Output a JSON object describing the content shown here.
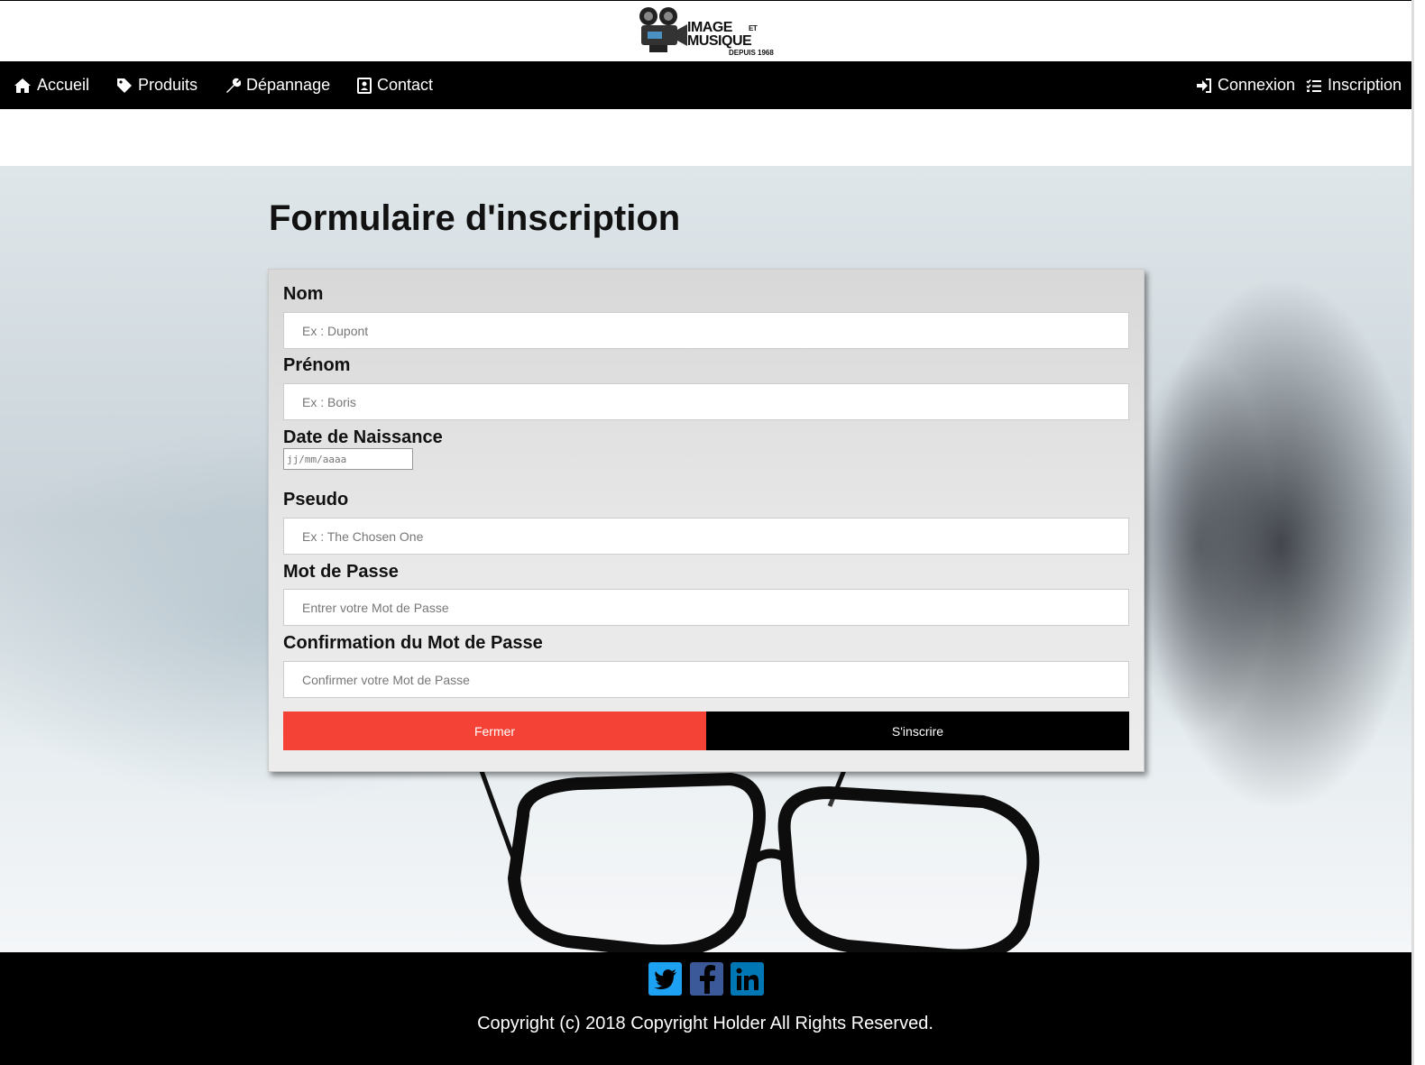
{
  "logo": {
    "line1": "IMAGE",
    "et": "ET",
    "line2": "MUSIQUE",
    "since": "DEPUIS 1968"
  },
  "nav": {
    "left": [
      {
        "label": "Accueil",
        "icon": "home-icon"
      },
      {
        "label": "Produits",
        "icon": "tag-icon"
      },
      {
        "label": "Dépannage",
        "icon": "wrench-icon"
      },
      {
        "label": "Contact",
        "icon": "contact-card-icon"
      }
    ],
    "right": [
      {
        "label": "Connexion",
        "icon": "sign-in-icon"
      },
      {
        "label": "Inscription",
        "icon": "checklist-icon"
      }
    ]
  },
  "form": {
    "title": "Formulaire d'inscription",
    "fields": {
      "nom": {
        "label": "Nom",
        "placeholder": "Ex : Dupont"
      },
      "prenom": {
        "label": "Prénom",
        "placeholder": "Ex : Boris"
      },
      "date": {
        "label": "Date de Naissance",
        "placeholder": "jj/mm/aaaa"
      },
      "pseudo": {
        "label": "Pseudo",
        "placeholder": "Ex : The Chosen One"
      },
      "password": {
        "label": "Mot de Passe",
        "placeholder": "Entrer votre Mot de Passe"
      },
      "confirm": {
        "label": "Confirmation du Mot de Passe",
        "placeholder": "Confirmer votre Mot de Passe"
      }
    },
    "buttons": {
      "close": "Fermer",
      "submit": "S'inscrire"
    }
  },
  "footer": {
    "social": [
      {
        "name": "twitter-icon",
        "color": "#1da1f2"
      },
      {
        "name": "facebook-icon",
        "color": "#3b5998"
      },
      {
        "name": "linkedin-icon",
        "color": "#0077b5"
      }
    ],
    "copyright": "Copyright (c) 2018 Copyright Holder All Rights Reserved."
  },
  "colors": {
    "close_button": "#f44336",
    "submit_button": "#000000",
    "navbar": "#000000"
  }
}
